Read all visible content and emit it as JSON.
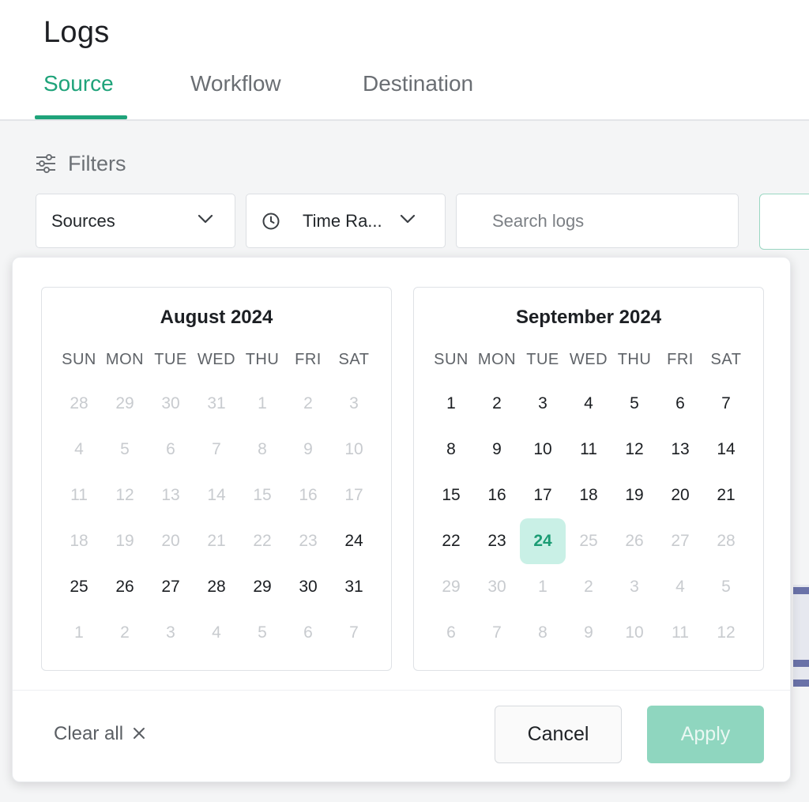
{
  "header": {
    "title": "Logs",
    "tabs": [
      {
        "label": "Source",
        "active": true
      },
      {
        "label": "Workflow",
        "active": false
      },
      {
        "label": "Destination",
        "active": false
      }
    ]
  },
  "filters": {
    "label": "Filters",
    "sources_label": "Sources",
    "time_range_label": "Time Ra...",
    "search_placeholder": "Search logs"
  },
  "datepicker": {
    "weekdays": [
      "SUN",
      "MON",
      "TUE",
      "WED",
      "THU",
      "FRI",
      "SAT"
    ],
    "months": [
      {
        "title": "August 2024",
        "weeks": [
          [
            {
              "d": "28",
              "o": true
            },
            {
              "d": "29",
              "o": true
            },
            {
              "d": "30",
              "o": true
            },
            {
              "d": "31",
              "o": true
            },
            {
              "d": "1",
              "o": true
            },
            {
              "d": "2",
              "o": true
            },
            {
              "d": "3",
              "o": true
            }
          ],
          [
            {
              "d": "4",
              "o": true
            },
            {
              "d": "5",
              "o": true
            },
            {
              "d": "6",
              "o": true
            },
            {
              "d": "7",
              "o": true
            },
            {
              "d": "8",
              "o": true
            },
            {
              "d": "9",
              "o": true
            },
            {
              "d": "10",
              "o": true
            }
          ],
          [
            {
              "d": "11",
              "o": true
            },
            {
              "d": "12",
              "o": true
            },
            {
              "d": "13",
              "o": true
            },
            {
              "d": "14",
              "o": true
            },
            {
              "d": "15",
              "o": true
            },
            {
              "d": "16",
              "o": true
            },
            {
              "d": "17",
              "o": true
            }
          ],
          [
            {
              "d": "18",
              "o": true
            },
            {
              "d": "19",
              "o": true
            },
            {
              "d": "20",
              "o": true
            },
            {
              "d": "21",
              "o": true
            },
            {
              "d": "22",
              "o": true
            },
            {
              "d": "23",
              "o": true
            },
            {
              "d": "24",
              "o": false
            }
          ],
          [
            {
              "d": "25",
              "o": false
            },
            {
              "d": "26",
              "o": false
            },
            {
              "d": "27",
              "o": false
            },
            {
              "d": "28",
              "o": false
            },
            {
              "d": "29",
              "o": false
            },
            {
              "d": "30",
              "o": false
            },
            {
              "d": "31",
              "o": false
            }
          ],
          [
            {
              "d": "1",
              "o": true
            },
            {
              "d": "2",
              "o": true
            },
            {
              "d": "3",
              "o": true
            },
            {
              "d": "4",
              "o": true
            },
            {
              "d": "5",
              "o": true
            },
            {
              "d": "6",
              "o": true
            },
            {
              "d": "7",
              "o": true
            }
          ]
        ]
      },
      {
        "title": "September 2024",
        "weeks": [
          [
            {
              "d": "1",
              "o": false
            },
            {
              "d": "2",
              "o": false
            },
            {
              "d": "3",
              "o": false
            },
            {
              "d": "4",
              "o": false
            },
            {
              "d": "5",
              "o": false
            },
            {
              "d": "6",
              "o": false
            },
            {
              "d": "7",
              "o": false
            }
          ],
          [
            {
              "d": "8",
              "o": false
            },
            {
              "d": "9",
              "o": false
            },
            {
              "d": "10",
              "o": false
            },
            {
              "d": "11",
              "o": false
            },
            {
              "d": "12",
              "o": false
            },
            {
              "d": "13",
              "o": false
            },
            {
              "d": "14",
              "o": false
            }
          ],
          [
            {
              "d": "15",
              "o": false
            },
            {
              "d": "16",
              "o": false
            },
            {
              "d": "17",
              "o": false
            },
            {
              "d": "18",
              "o": false
            },
            {
              "d": "19",
              "o": false
            },
            {
              "d": "20",
              "o": false
            },
            {
              "d": "21",
              "o": false
            }
          ],
          [
            {
              "d": "22",
              "o": false
            },
            {
              "d": "23",
              "o": false
            },
            {
              "d": "24",
              "o": false,
              "selected": true
            },
            {
              "d": "25",
              "o": true
            },
            {
              "d": "26",
              "o": true
            },
            {
              "d": "27",
              "o": true
            },
            {
              "d": "28",
              "o": true
            }
          ],
          [
            {
              "d": "29",
              "o": true
            },
            {
              "d": "30",
              "o": true
            },
            {
              "d": "1",
              "o": true
            },
            {
              "d": "2",
              "o": true
            },
            {
              "d": "3",
              "o": true
            },
            {
              "d": "4",
              "o": true
            },
            {
              "d": "5",
              "o": true
            }
          ],
          [
            {
              "d": "6",
              "o": true
            },
            {
              "d": "7",
              "o": true
            },
            {
              "d": "8",
              "o": true
            },
            {
              "d": "9",
              "o": true
            },
            {
              "d": "10",
              "o": true
            },
            {
              "d": "11",
              "o": true
            },
            {
              "d": "12",
              "o": true
            }
          ]
        ]
      }
    ],
    "clear_all_label": "Clear all",
    "cancel_label": "Cancel",
    "apply_label": "Apply"
  },
  "colors": {
    "accent": "#1fa37a",
    "selected_day_bg": "#c9f0e6",
    "apply_button": "#8fd6bf"
  }
}
